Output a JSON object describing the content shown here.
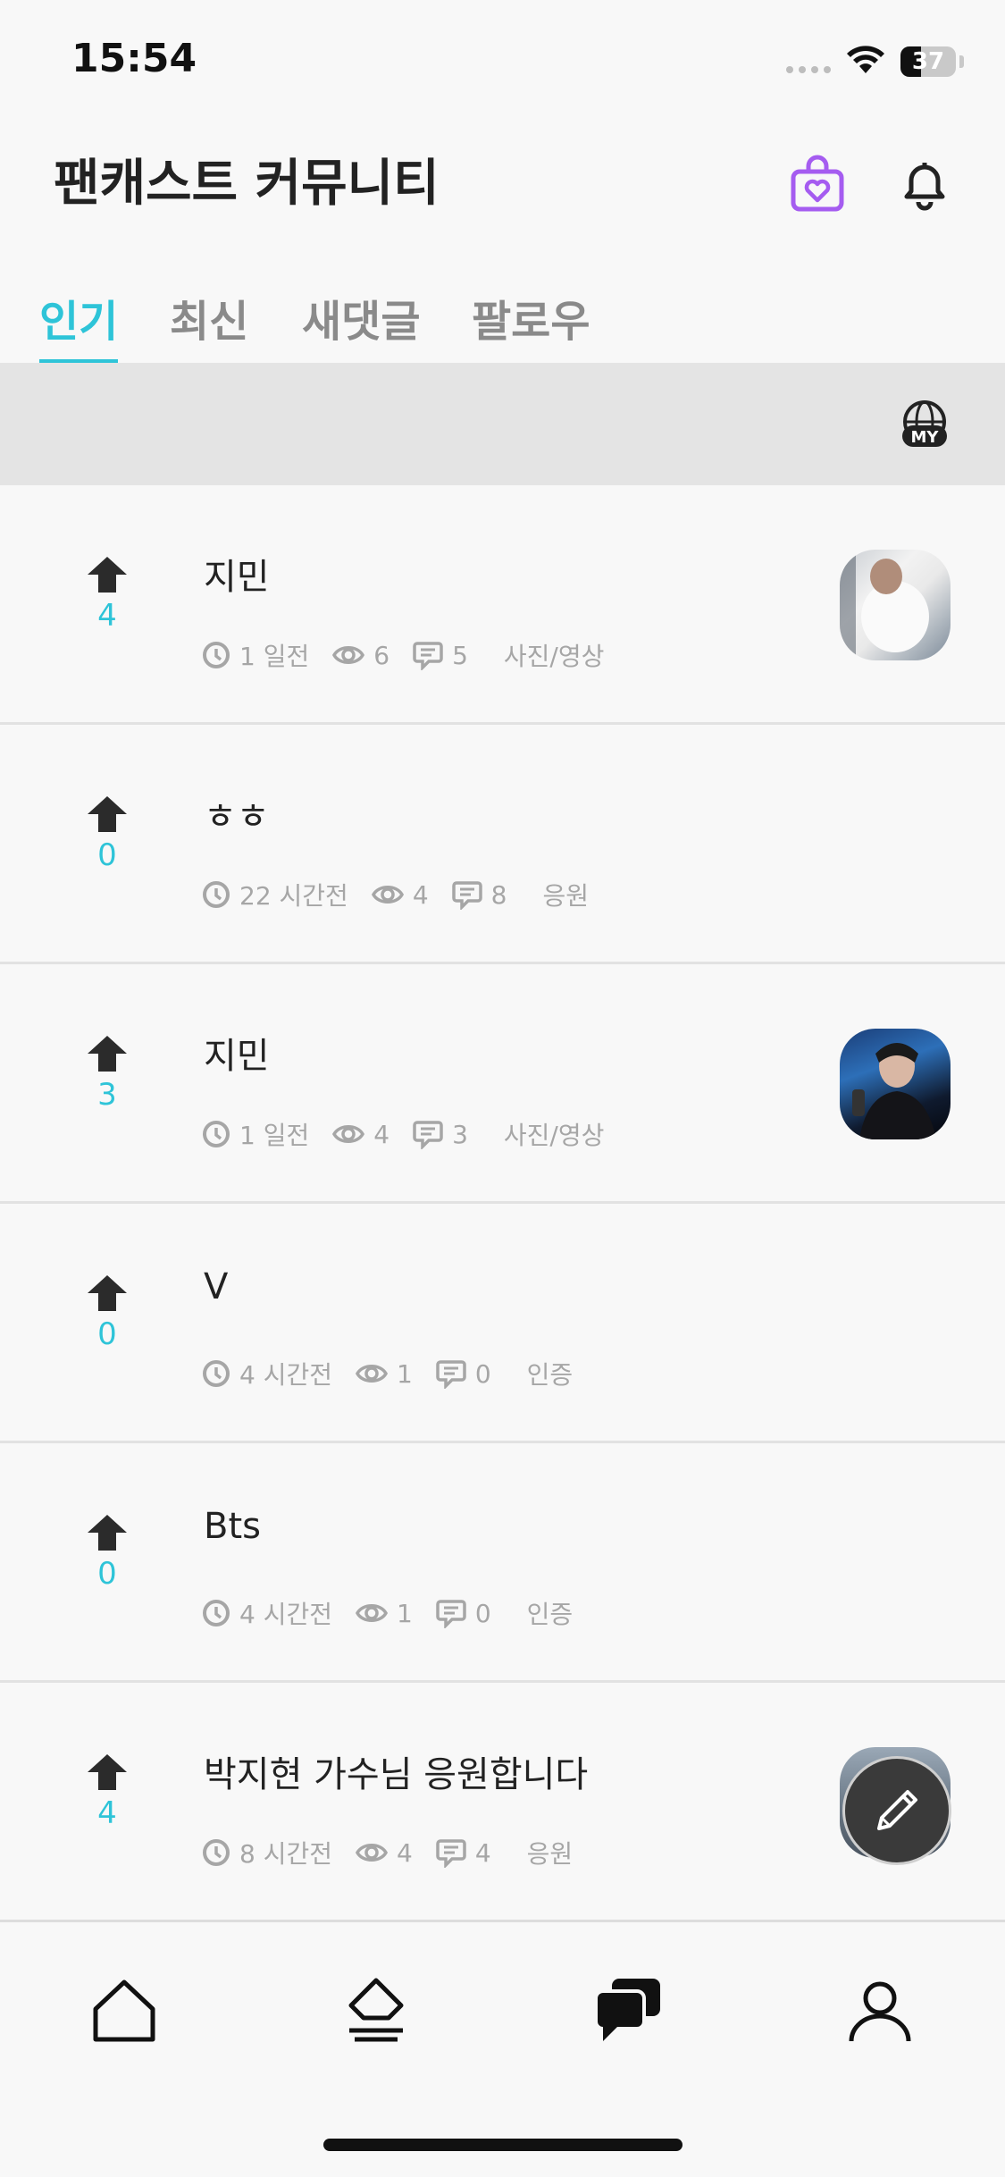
{
  "status_bar": {
    "time": "15:54",
    "battery_percent": "37",
    "battery_level": 0.37
  },
  "header": {
    "title": "팬캐스트 커뮤니티",
    "icons": [
      "shopping-bag-heart-icon",
      "bell-icon"
    ]
  },
  "tabs": [
    {
      "label": "인기",
      "active": true
    },
    {
      "label": "최신",
      "active": false
    },
    {
      "label": "새댓글",
      "active": false
    },
    {
      "label": "팔로우",
      "active": false
    }
  ],
  "filter_bar": {
    "icon": "my-globe-icon",
    "icon_text": "MY"
  },
  "posts": [
    {
      "votes": "4",
      "title": "지민",
      "time": "1 일전",
      "views": "6",
      "comments": "5",
      "category": "사진/영상",
      "has_thumbnail": true
    },
    {
      "votes": "0",
      "title": "ㅎㅎ",
      "time": "22 시간전",
      "views": "4",
      "comments": "8",
      "category": "응원",
      "has_thumbnail": false
    },
    {
      "votes": "3",
      "title": "지민",
      "time": "1 일전",
      "views": "4",
      "comments": "3",
      "category": "사진/영상",
      "has_thumbnail": true
    },
    {
      "votes": "0",
      "title": "V",
      "time": "4 시간전",
      "views": "1",
      "comments": "0",
      "category": "인증",
      "has_thumbnail": false
    },
    {
      "votes": "0",
      "title": "Bts",
      "time": "4 시간전",
      "views": "1",
      "comments": "0",
      "category": "인증",
      "has_thumbnail": false
    },
    {
      "votes": "4",
      "title": "박지현 가수님 응원합니다",
      "time": "8 시간전",
      "views": "4",
      "comments": "4",
      "category": "응원",
      "has_thumbnail": true
    }
  ],
  "fab": {
    "icon": "pencil-icon"
  },
  "bottom_nav": [
    {
      "icon": "home-icon",
      "active": false
    },
    {
      "icon": "vote-icon",
      "active": false
    },
    {
      "icon": "community-chat-icon",
      "active": true
    },
    {
      "icon": "profile-icon",
      "active": false
    }
  ],
  "colors": {
    "accent": "#2ec4d8",
    "shop_icon": "#a55cf0",
    "filter_bar": "#e4e4e4"
  }
}
